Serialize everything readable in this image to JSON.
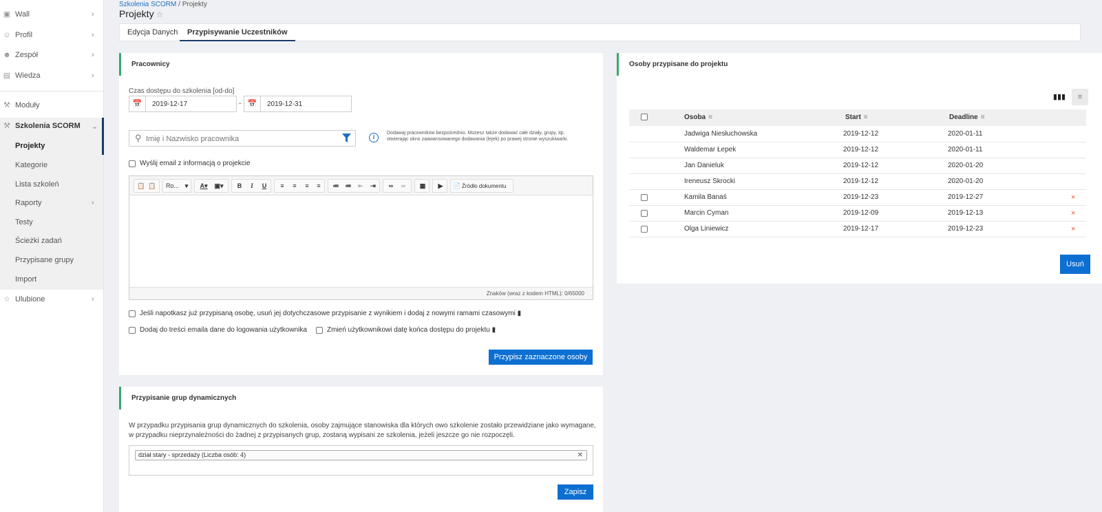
{
  "sidebar": {
    "items": [
      {
        "label": "Wall",
        "icon": "wall-icon"
      },
      {
        "label": "Profil",
        "icon": "user-icon"
      },
      {
        "label": "Zespół",
        "icon": "team-icon"
      },
      {
        "label": "Wiedza",
        "icon": "book-icon"
      },
      {
        "label": "Moduły",
        "icon": "wrench-icon"
      },
      {
        "label": "Szkolenia SCORM",
        "icon": "wrench-icon"
      },
      {
        "label": "Ulubione",
        "icon": "star-icon"
      }
    ],
    "sub_items": [
      "Projekty",
      "Kategorie",
      "Lista szkoleń",
      "Raporty",
      "Testy",
      "Ścieżki zadań",
      "Przypisane grupy",
      "Import"
    ]
  },
  "header": {
    "breadcrumb_link": "Szkolenia SCORM",
    "breadcrumb_sep": " / ",
    "breadcrumb_current": "Projekty",
    "title": "Projekty"
  },
  "tabs": [
    "Edycja Danych",
    "Przypisywanie Uczestników"
  ],
  "employees": {
    "title": "Pracownicy",
    "access_label": "Czas dostępu do szkolenia [od-do]",
    "date_from": "2019-12-17",
    "date_sep": "-",
    "date_to": "2019-12-31",
    "search_placeholder": "Imię i Nazwisko pracownika",
    "info_line1": "Dodawaj pracowników bezpośrednio. Możesz także dodawać całe działy, grupy, itp.",
    "info_line2": "otwierając okno zaawansowanego dodawania (lejek) po prawej stronie wyszukiwarki.",
    "send_email_label": "Wyślij email z informacją o projekcie",
    "toolbar_font": "Ro...",
    "toolbar_source": "Źródło dokumentu",
    "char_count": "Znaków (wraz z kodem HTML): 0/65000",
    "opt_replace": "Jeśli napotkasz już przypisaną osobę, usuń jej dotychczasowe przypisanie z wynikiem i dodaj z nowymi ramami czasowymi",
    "opt_login": "Dodaj do treści emaila dane do logowania użytkownika",
    "opt_enddate": "Zmień użytkownikowi datę końca dostępu do projektu",
    "assign_button": "Przypisz zaznaczone osoby"
  },
  "dynamic": {
    "title": "Przypisanie grup dynamicznych",
    "desc_line1": "W przypadku przypisania grup dynamicznych do szkolenia, osoby zajmujące stanowiska dla których owo szkolenie zostało przewidziane jako wymagane,",
    "desc_line2": "w przypadku nieprzynależności do żadnej z przypisanych grup, zostaną wypisani ze szkolenia, jeżeli jeszcze go nie rozpoczęli.",
    "tag": "dział stary - sprzedaży (Liczba osób: 4)",
    "save_button": "Zapisz"
  },
  "assigned": {
    "title": "Osoby przypisane do projektu",
    "columns": [
      "Osoba",
      "Start",
      "Deadline"
    ],
    "rows": [
      {
        "name": "Jadwiga Niesłuchowska",
        "start": "2019-12-12",
        "deadline": "2020-01-11",
        "removable": false
      },
      {
        "name": "Waldemar Łepek",
        "start": "2019-12-12",
        "deadline": "2020-01-11",
        "removable": false
      },
      {
        "name": "Jan Danieluk",
        "start": "2019-12-12",
        "deadline": "2020-01-20",
        "removable": false
      },
      {
        "name": "Ireneusz Skrocki",
        "start": "2019-12-12",
        "deadline": "2020-01-20",
        "removable": false
      },
      {
        "name": "Kamila Banaś",
        "start": "2019-12-23",
        "deadline": "2019-12-27",
        "removable": true
      },
      {
        "name": "Marcin Cyman",
        "start": "2019-12-09",
        "deadline": "2019-12-13",
        "removable": true
      },
      {
        "name": "Olga Liniewicz",
        "start": "2019-12-17",
        "deadline": "2019-12-23",
        "removable": true
      }
    ],
    "remove_button": "Usuń"
  },
  "colors": {
    "primary": "#0d6fd1",
    "accent": "#3aa66c",
    "nav_active": "#1a3a6b",
    "delete": "#e05a2a"
  }
}
